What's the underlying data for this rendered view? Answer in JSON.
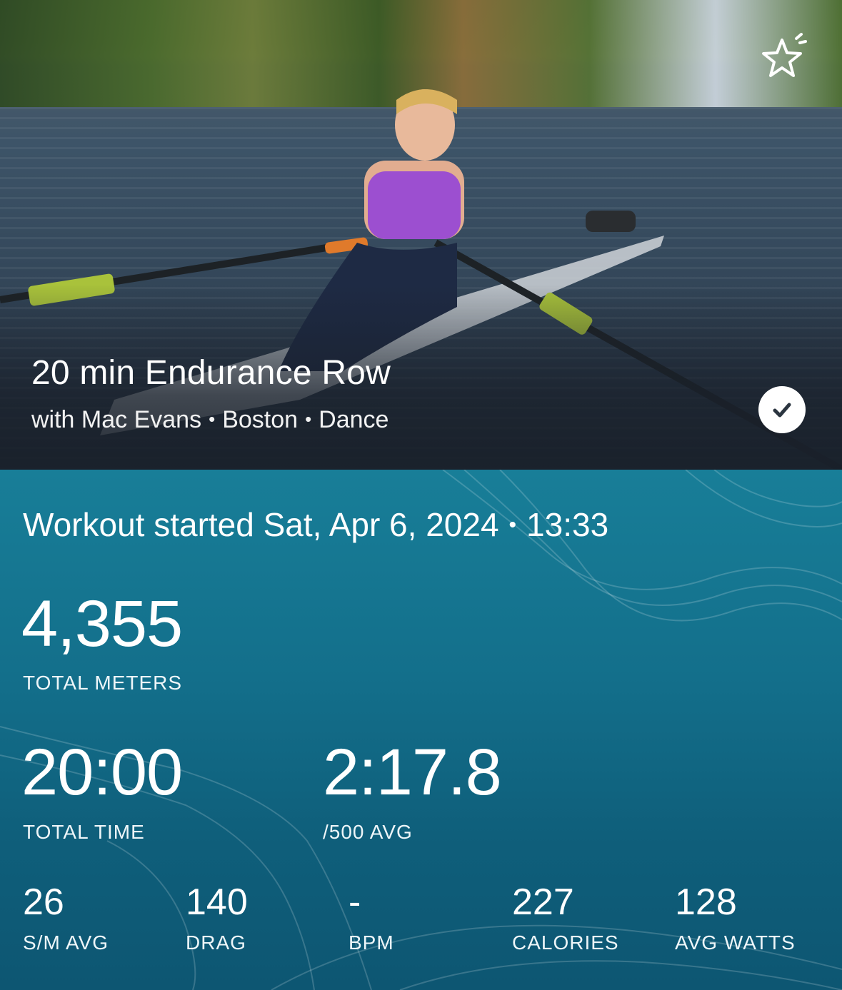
{
  "workout": {
    "title": "20 min Endurance Row",
    "instructor": "with Mac Evans",
    "location": "Boston",
    "music": "Dance",
    "completed": true,
    "favorited": false
  },
  "started": {
    "label": "Workout started Sat, Apr 6, 2024",
    "time": "13:33"
  },
  "primary_stats": [
    {
      "value": "4,355",
      "label": "TOTAL METERS"
    },
    {
      "value": "20:00",
      "label": "TOTAL TIME"
    },
    {
      "value": "2:17.8",
      "label": "/500 AVG"
    }
  ],
  "secondary_stats": [
    {
      "value": "26",
      "label": "S/M AVG"
    },
    {
      "value": "140",
      "label": "DRAG"
    },
    {
      "value": "-",
      "label": "BPM"
    },
    {
      "value": "227",
      "label": "CALORIES"
    },
    {
      "value": "128",
      "label": "AVG WATTS"
    }
  ],
  "icons": {
    "favorite": "star-add-icon",
    "completed": "checkmark-icon"
  },
  "colors": {
    "stats_background": "#136f8b",
    "text": "#ffffff"
  }
}
